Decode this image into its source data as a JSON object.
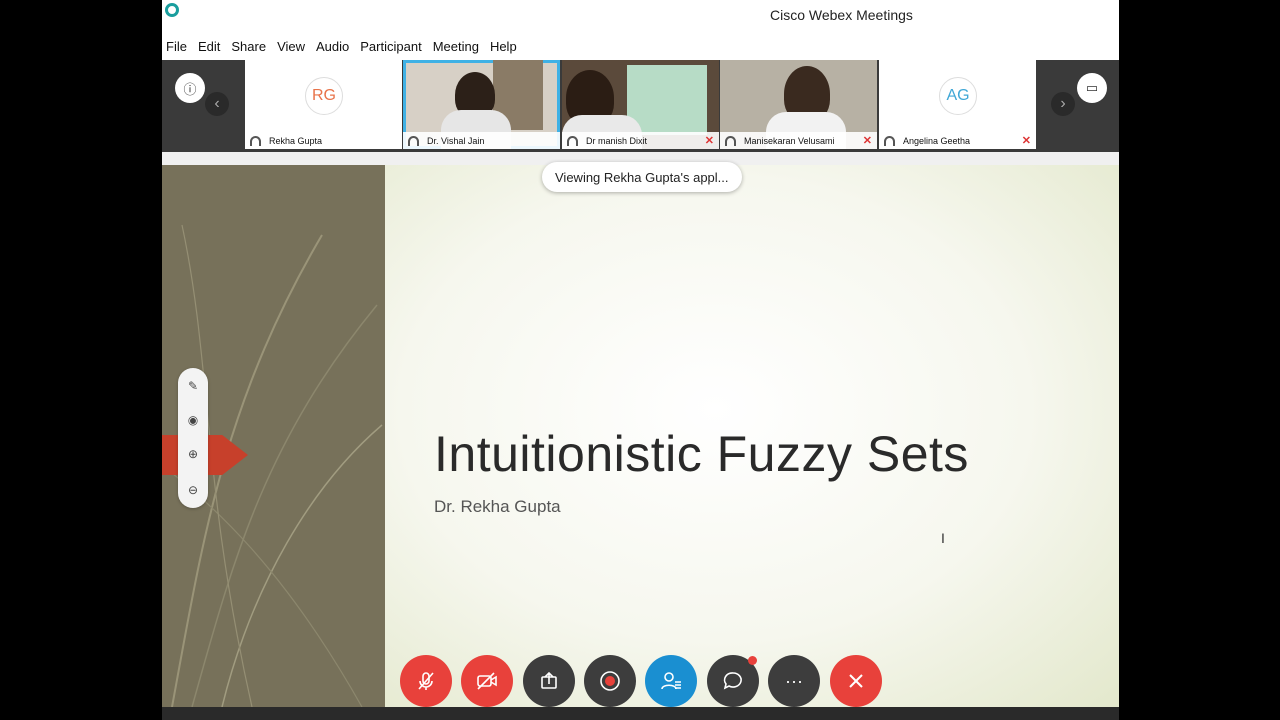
{
  "window": {
    "title": "Cisco Webex Meetings"
  },
  "menu": [
    "File",
    "Edit",
    "Share",
    "View",
    "Audio",
    "Participant",
    "Meeting",
    "Help"
  ],
  "participants": [
    {
      "name": "Rekha Gupta",
      "initials": "RG",
      "initials_color": "#e8734a"
    },
    {
      "name": "Dr. Vishal Jain",
      "active": true
    },
    {
      "name": "Dr manish Dixit",
      "muted": true
    },
    {
      "name": "Manisekaran Velusami",
      "muted": true
    },
    {
      "name": "Angelina Geetha",
      "initials": "AG",
      "initials_color": "#3fa7d6",
      "muted": true
    }
  ],
  "toast": "Viewing Rekha Gupta's appl...",
  "slide": {
    "title": "Intuitionistic Fuzzy Sets",
    "subtitle": "Dr. Rekha Gupta"
  },
  "icons": {
    "mute": "microphone-off-icon",
    "video": "video-off-icon",
    "share": "share-icon",
    "record": "record-icon",
    "participants": "participants-icon",
    "chat": "chat-icon",
    "more": "more-icon",
    "leave": "leave-icon"
  }
}
